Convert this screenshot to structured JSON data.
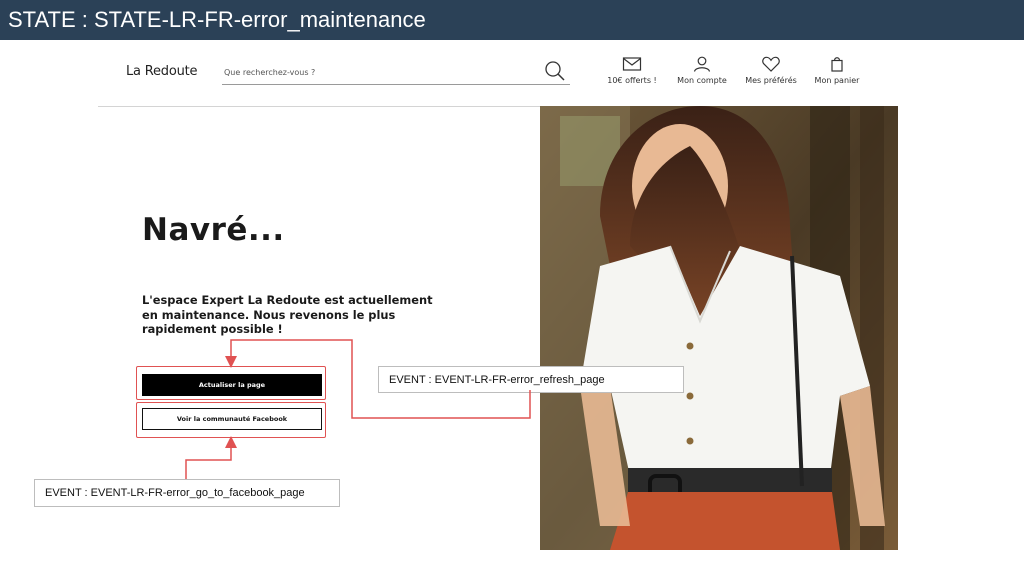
{
  "state_label": "STATE : STATE-LR-FR-error_maintenance",
  "header": {
    "logo": "La Redoute",
    "search_placeholder": "Que recherchez-vous ?",
    "nav": [
      {
        "label": "10€ offerts !",
        "icon": "mail-icon"
      },
      {
        "label": "Mon compte",
        "icon": "user-icon"
      },
      {
        "label": "Mes préférés",
        "icon": "heart-icon"
      },
      {
        "label": "Mon panier",
        "icon": "shopping-bag-icon"
      }
    ]
  },
  "main": {
    "title": "Navré...",
    "message": "L'espace Expert La Redoute est actuellement en maintenance. Nous revenons le plus rapidement possible !",
    "refresh_button": "Actualiser la page",
    "facebook_button": "Voir la communauté Facebook"
  },
  "annotations": {
    "refresh_event": "EVENT : EVENT-LR-FR-error_refresh_page",
    "facebook_event": "EVENT : EVENT-LR-FR-error_go_to_facebook_page"
  },
  "colors": {
    "state_bar": "#2b4157",
    "highlight": "#e05252",
    "primary_button": "#000000"
  }
}
